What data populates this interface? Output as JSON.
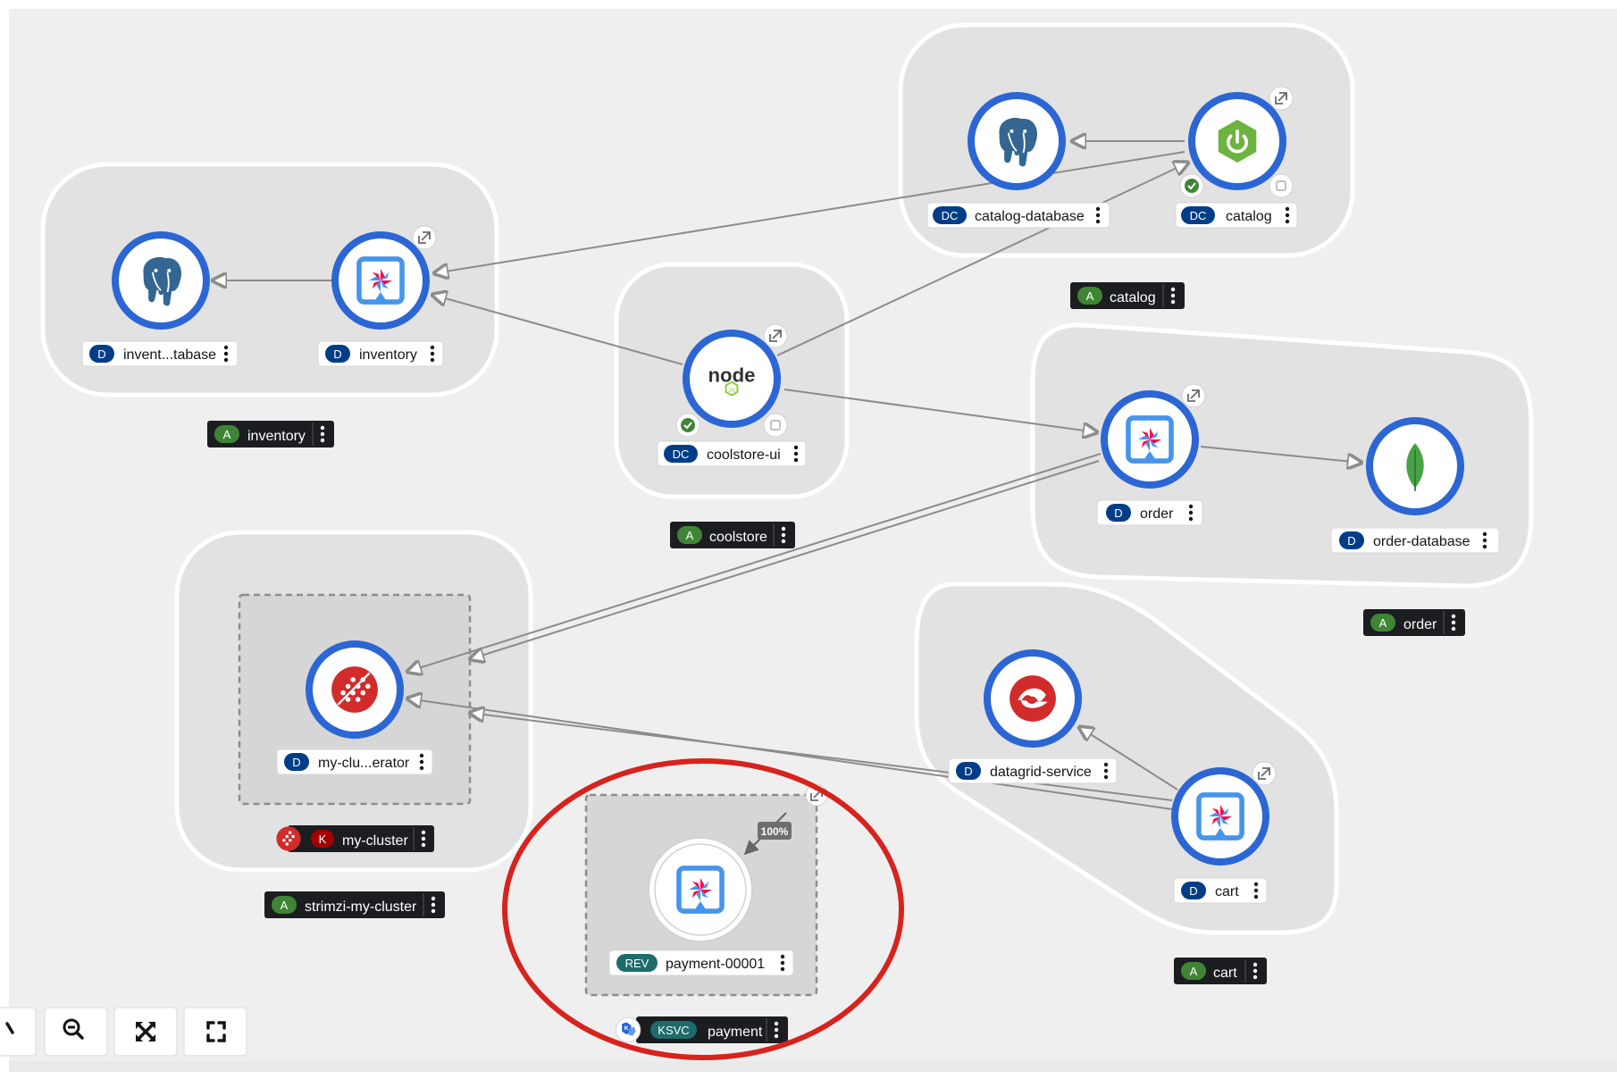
{
  "colors": {
    "canvas": "#efefef",
    "group_fill": "#e2e2e2",
    "node_ring": "#2b66d4",
    "badge_dc_d": "#003d87",
    "badge_app": "#3e8635",
    "badge_kafka": "#a30000",
    "badge_knative": "#1d6b6b",
    "highlight": "#d7231d"
  },
  "topology": {
    "groups": [
      {
        "id": "catalog",
        "badge": "A",
        "label": "catalog"
      },
      {
        "id": "inventory",
        "badge": "A",
        "label": "inventory"
      },
      {
        "id": "coolstore",
        "badge": "A",
        "label": "coolstore"
      },
      {
        "id": "order",
        "badge": "A",
        "label": "order"
      },
      {
        "id": "strimzi",
        "badge": "A",
        "label": "strimzi-my-cluster"
      },
      {
        "id": "cart",
        "badge": "A",
        "label": "cart"
      }
    ],
    "nodes": [
      {
        "id": "catalog-database",
        "badge": "DC",
        "label": "catalog-database",
        "icon": "postgresql-icon"
      },
      {
        "id": "catalog",
        "badge": "DC",
        "label": "catalog",
        "icon": "spring-boot-icon"
      },
      {
        "id": "inventory-database",
        "badge": "D",
        "label": "invent...tabase",
        "icon": "postgresql-icon"
      },
      {
        "id": "inventory",
        "badge": "D",
        "label": "inventory",
        "icon": "quarkus-icon"
      },
      {
        "id": "coolstore-ui",
        "badge": "DC",
        "label": "coolstore-ui",
        "icon": "nodejs-icon"
      },
      {
        "id": "order",
        "badge": "D",
        "label": "order",
        "icon": "quarkus-icon"
      },
      {
        "id": "order-database",
        "badge": "D",
        "label": "order-database",
        "icon": "mongodb-icon"
      },
      {
        "id": "my-cluster-operator",
        "badge": "D",
        "label": "my-clu...erator",
        "icon": "strimzi-icon"
      },
      {
        "id": "datagrid-service",
        "badge": "D",
        "label": "datagrid-service",
        "icon": "datagrid-icon"
      },
      {
        "id": "cart",
        "badge": "D",
        "label": "cart",
        "icon": "quarkus-icon"
      },
      {
        "id": "payment-00001",
        "badge": "REV",
        "label": "payment-00001",
        "icon": "quarkus-icon"
      }
    ],
    "kafka": {
      "badge": "K",
      "label": "my-cluster",
      "icon": "kafka-icon"
    },
    "ksvc": {
      "badge": "KSVC",
      "label": "payment",
      "icon": "knative-icon"
    },
    "traffic_label": "100%"
  },
  "controls": [
    {
      "id": "zoom-in",
      "icon": "zoom-in-icon"
    },
    {
      "id": "zoom-out",
      "icon": "zoom-out-icon"
    },
    {
      "id": "fit-to-screen",
      "icon": "fit-to-screen-icon"
    },
    {
      "id": "reset-view",
      "icon": "expand-icon"
    }
  ]
}
